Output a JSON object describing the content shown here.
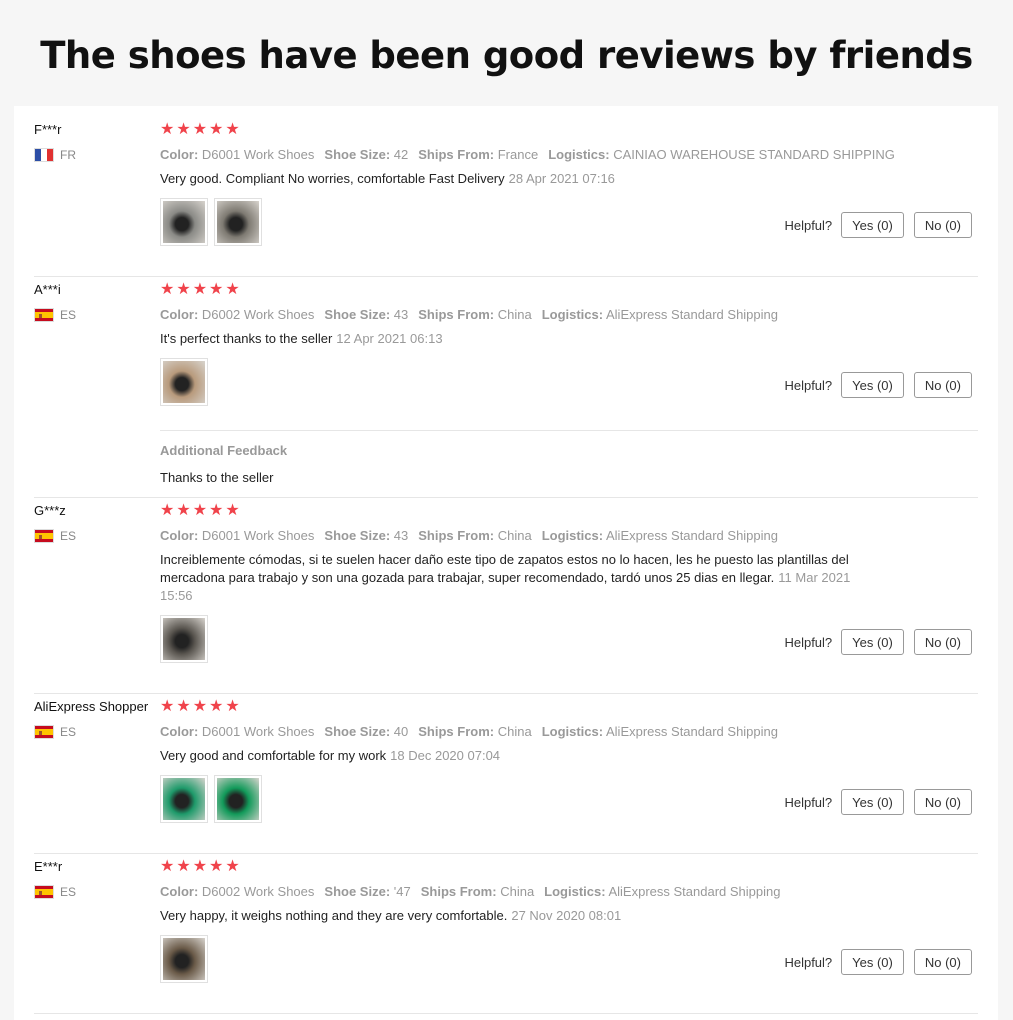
{
  "page_title": "The shoes have been good reviews by friends",
  "labels": {
    "color": "Color:",
    "shoe_size": "Shoe Size:",
    "ships_from": "Ships From:",
    "logistics": "Logistics:",
    "helpful": "Helpful?",
    "yes": "Yes (0)",
    "no": "No (0)",
    "additional_feedback": "Additional Feedback"
  },
  "reviews": [
    {
      "user": "F***r",
      "country": "FR",
      "flag": "flag-fr",
      "rating": 5,
      "color": "D6001 Work Shoes",
      "shoe_size": "42",
      "ships_from": "France",
      "logistics": "CAINIAO WAREHOUSE STANDARD SHIPPING",
      "text": "Very good. Compliant No worries, comfortable Fast Delivery",
      "date": "28 Apr 2021 07:16",
      "photos": [
        "#8a8a86",
        "#7e7a72"
      ]
    },
    {
      "user": "A***i",
      "country": "ES",
      "flag": "flag-es",
      "rating": 5,
      "color": "D6002 Work Shoes",
      "shoe_size": "43",
      "ships_from": "China",
      "logistics": "AliExpress Standard Shipping",
      "text": "It's perfect thanks to the seller",
      "date": "12 Apr 2021 06:13",
      "photos": [
        "#b89a7c"
      ],
      "additional_feedback": "Thanks to the seller"
    },
    {
      "user": "G***z",
      "country": "ES",
      "flag": "flag-es",
      "rating": 5,
      "color": "D6001 Work Shoes",
      "shoe_size": "43",
      "ships_from": "China",
      "logistics": "AliExpress Standard Shipping",
      "text": "Increiblemente cómodas, si te suelen hacer daño este tipo de zapatos estos no lo hacen, les he puesto las plantillas del mercadona para trabajo y son una gozada para trabajar, super recomendado, tardó unos 25 dias en llegar.",
      "date": "11 Mar 2021 15:56",
      "photos": [
        "#5a5650"
      ]
    },
    {
      "user": "AliExpress Shopper",
      "country": "ES",
      "flag": "flag-es",
      "rating": 5,
      "color": "D6001 Work Shoes",
      "shoe_size": "40",
      "ships_from": "China",
      "logistics": "AliExpress Standard Shipping",
      "text": "Very good and comfortable for my work",
      "date": "18 Dec 2020 07:04",
      "photos": [
        "#1e9a6a",
        "#129a5a"
      ]
    },
    {
      "user": "E***r",
      "country": "ES",
      "flag": "flag-es",
      "rating": 5,
      "color": "D6002 Work Shoes",
      "shoe_size": "'47",
      "ships_from": "China",
      "logistics": "AliExpress Standard Shipping",
      "text": "Very happy, it weighs nothing and they are very comfortable.",
      "date": "27 Nov 2020 08:01",
      "photos": [
        "#6a5a48"
      ]
    }
  ]
}
